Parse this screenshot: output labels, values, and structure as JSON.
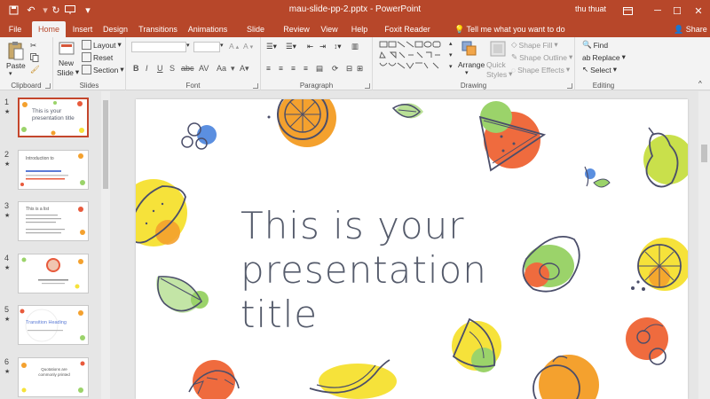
{
  "app": {
    "document_title": "mau-slide-pp-2.pptx - PowerPoint",
    "user": "thu thuat"
  },
  "tabs": [
    "File",
    "Home",
    "Insert",
    "Design",
    "Transitions",
    "Animations",
    "Slide Show",
    "Review",
    "View",
    "Help",
    "Foxit Reader PDF"
  ],
  "tell_me": "Tell me what you want to do",
  "share": "Share",
  "ribbon": {
    "clipboard": {
      "label": "Clipboard",
      "paste": "Paste"
    },
    "slides": {
      "label": "Slides",
      "new_slide": "New",
      "new_slide_2": "Slide",
      "layout": "Layout",
      "reset": "Reset",
      "section": "Section"
    },
    "font": {
      "label": "Font"
    },
    "paragraph": {
      "label": "Paragraph"
    },
    "drawing": {
      "label": "Drawing",
      "arrange": "Arrange",
      "quick_styles": "Quick",
      "quick_styles_2": "Styles",
      "shape_fill": "Shape Fill",
      "shape_outline": "Shape Outline",
      "shape_effects": "Shape Effects"
    },
    "editing": {
      "label": "Editing",
      "find": "Find",
      "replace": "Replace",
      "select": "Select"
    }
  },
  "thumbnails": [
    {
      "number": "1",
      "text": "This is your presentation title"
    },
    {
      "number": "2",
      "text": "Introduction to"
    },
    {
      "number": "3",
      "text": "This is a list"
    },
    {
      "number": "4",
      "text": "Insert"
    },
    {
      "number": "5",
      "text": "Transition Heading"
    },
    {
      "number": "6",
      "text": "Quotations are commonly printed"
    }
  ],
  "slide": {
    "title_line1": "This is your",
    "title_line2": "presentation title"
  },
  "colors": {
    "accent": "#b7472a",
    "ribbon_bg": "#f3f3f3",
    "title_text": "#555b6b"
  }
}
